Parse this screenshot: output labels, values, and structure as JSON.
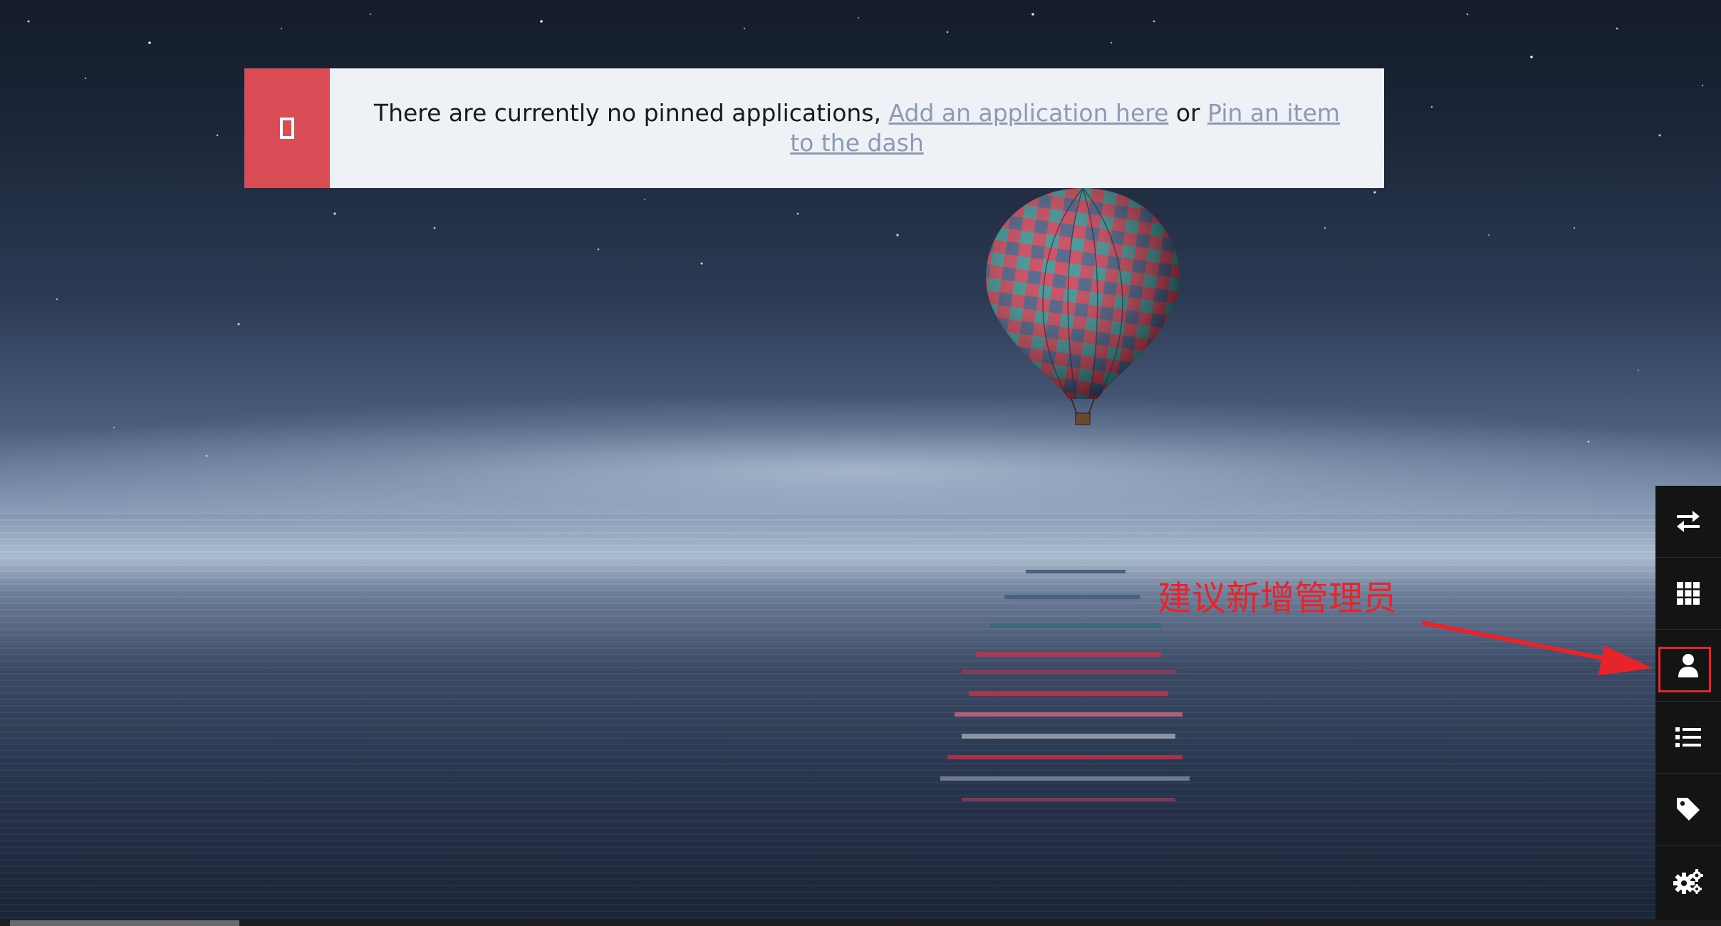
{
  "alert": {
    "icon": "file-outline-icon",
    "message_prefix": "There are currently no pinned applications, ",
    "link_add_app": "Add an application here",
    "connector": " or ",
    "link_pin_item": "Pin an item to the dash",
    "colors": {
      "icon_box": "#d94b55",
      "background": "#eef2f6",
      "link": "#8a9bb2"
    }
  },
  "annotation": {
    "text": "建议新增管理员",
    "color": "#e8242b"
  },
  "sidebar": {
    "items": [
      {
        "icon": "swap-arrows-icon"
      },
      {
        "icon": "app-grid-icon"
      },
      {
        "icon": "user-icon",
        "highlighted": true
      },
      {
        "icon": "list-icon"
      },
      {
        "icon": "tag-icon"
      },
      {
        "icon": "settings-gears-icon"
      }
    ]
  }
}
